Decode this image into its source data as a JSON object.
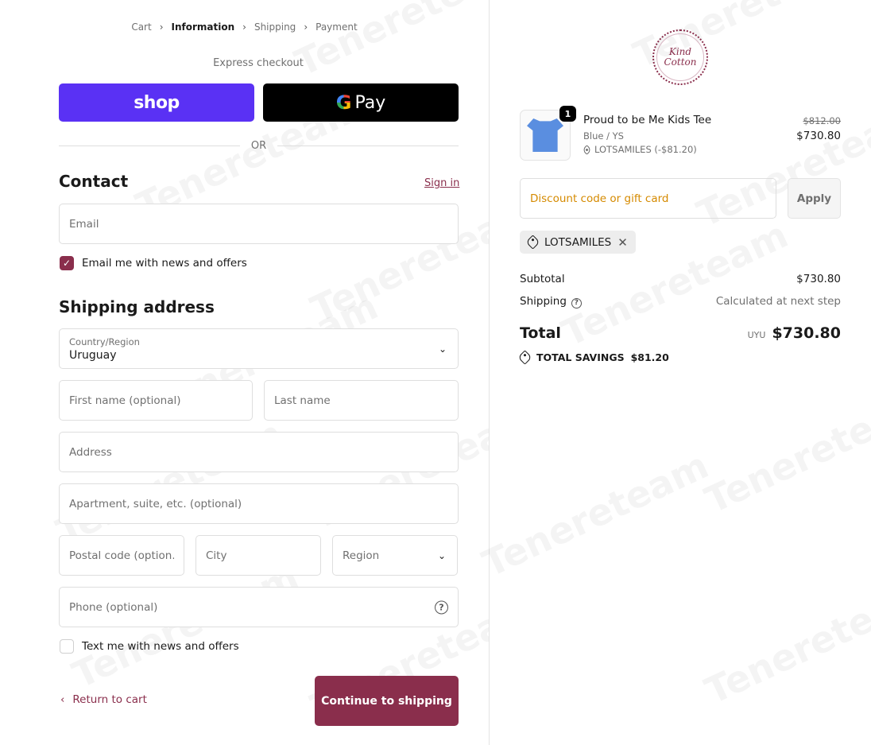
{
  "breadcrumb": {
    "cart": "Cart",
    "information": "Information",
    "shipping": "Shipping",
    "payment": "Payment"
  },
  "express": {
    "title": "Express checkout",
    "shop_label": "shop",
    "gpay_g": "G",
    "gpay_label": "Pay",
    "or_label": "OR"
  },
  "contact": {
    "title": "Contact",
    "sign_in": "Sign in",
    "email_placeholder": "Email",
    "email_news_label": "Email me with news and offers",
    "email_news_checked": true
  },
  "shipping": {
    "title": "Shipping address",
    "country_label": "Country/Region",
    "country_value": "Uruguay",
    "first_name_placeholder": "First name (optional)",
    "last_name_placeholder": "Last name",
    "address_placeholder": "Address",
    "apartment_placeholder": "Apartment, suite, etc. (optional)",
    "postal_placeholder": "Postal code (option...",
    "city_placeholder": "City",
    "region_placeholder": "Region",
    "phone_placeholder": "Phone (optional)",
    "text_news_label": "Text me with news and offers",
    "text_news_checked": false
  },
  "actions": {
    "return_label": "Return to cart",
    "continue_label": "Continue to shipping"
  },
  "brand": {
    "logo_line1": "Kind",
    "logo_line2": "Cotton",
    "accent_color": "#8a2e4c",
    "shop_color": "#5a31f4"
  },
  "product": {
    "quantity": "1",
    "name": "Proud to be Me Kids Tee",
    "variant": "Blue / YS",
    "discount": "LOTSAMILES (-$81.20)",
    "original_price": "$812.00",
    "price": "$730.80"
  },
  "discount": {
    "placeholder": "Discount code or gift card",
    "apply_label": "Apply",
    "applied_code": "LOTSAMILES"
  },
  "summary": {
    "subtotal_label": "Subtotal",
    "subtotal_value": "$730.80",
    "shipping_label": "Shipping",
    "shipping_value": "Calculated at next step",
    "total_label": "Total",
    "currency": "UYU",
    "total_value": "$730.80",
    "savings_label": "TOTAL SAVINGS",
    "savings_value": "$81.20"
  },
  "watermark": {
    "text": "Tenereteam"
  }
}
